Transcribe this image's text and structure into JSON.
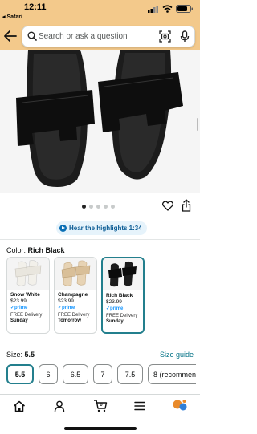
{
  "status": {
    "time": "12:11",
    "back_app": "◂ Safari"
  },
  "search": {
    "placeholder": "Search or ask a question"
  },
  "gallery": {
    "dot_count": 5,
    "active_dot": 0
  },
  "highlights": {
    "label": "Hear the highlights 1:34"
  },
  "color": {
    "label": "Color:",
    "selected": "Rich Black"
  },
  "swatches": [
    {
      "name": "Snow White",
      "price": "$23.99",
      "prime": "prime",
      "delivery": "FREE Delivery",
      "day": "Sunday",
      "selected": false,
      "shoe_color": "#f2f0ea"
    },
    {
      "name": "Champagne",
      "price": "$23.99",
      "prime": "prime",
      "delivery": "FREE Delivery",
      "day": "Tomorrow",
      "selected": false,
      "shoe_color": "#e7d3b4"
    },
    {
      "name": "Rich Black",
      "price": "$23.99",
      "prime": "prime",
      "delivery": "FREE Delivery",
      "day": "Sunday",
      "selected": true,
      "shoe_color": "#1b1b1b"
    }
  ],
  "size": {
    "label": "Size:",
    "selected": "5.5",
    "guide": "Size guide",
    "options": [
      "5.5",
      "6",
      "6.5",
      "7",
      "7.5",
      "8 (recommen"
    ]
  },
  "colors": {
    "header_bg": "#f3c98b",
    "accent": "#237f8d",
    "link": "#007185"
  }
}
